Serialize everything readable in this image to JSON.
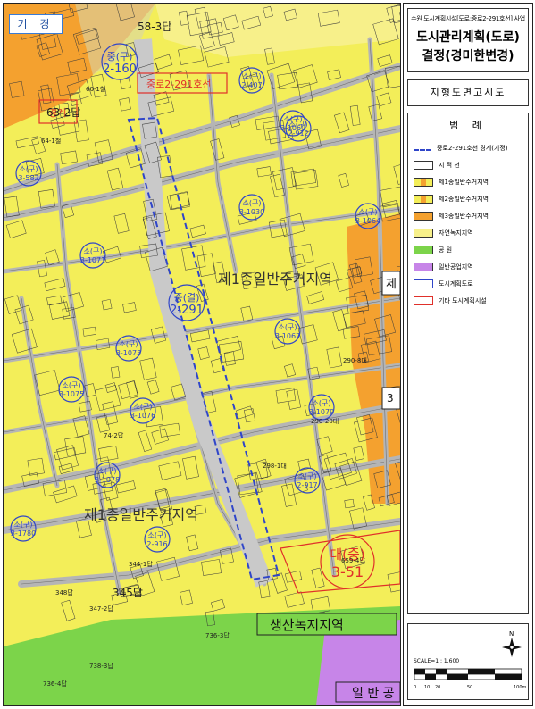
{
  "map": {
    "corner_tag": "기 경",
    "zone_labels": {
      "zone_1": "제1종일반주거지역",
      "zone_2": "제1종일반주거지역",
      "green": "생산녹지지역",
      "general": "일 반 공",
      "side_1": "제",
      "side_2": "3"
    },
    "road_labels": [
      {
        "top": "중(구)",
        "code": "2-160"
      },
      {
        "top": "소(구)",
        "code": "2-407"
      },
      {
        "top": "소(구)",
        "code": "3-1060"
      },
      {
        "top": "소(구)",
        "code": "2-912"
      },
      {
        "top": "소(구)",
        "code": "3-582"
      },
      {
        "top": "소(구)",
        "code": "3-1030"
      },
      {
        "top": "소(구)",
        "code": "3-1064"
      },
      {
        "top": "소(구)",
        "code": "3-1071"
      },
      {
        "top": "중(결)",
        "code": "2-291"
      },
      {
        "top": "소(구)",
        "code": "3-1067"
      },
      {
        "top": "소(구)",
        "code": "3-1073"
      },
      {
        "top": "소(구)",
        "code": "3-1075"
      },
      {
        "top": "소(구)",
        "code": "3-1076"
      },
      {
        "top": "소(구)",
        "code": "3-1079"
      },
      {
        "top": "소(구)",
        "code": "3-1078"
      },
      {
        "top": "소(구)",
        "code": "2-917"
      },
      {
        "top": "소(구)",
        "code": "3-1780"
      },
      {
        "top": "소(구)",
        "code": "2-916"
      }
    ],
    "facility_labels": [
      {
        "top": "대(중)",
        "code": "3-51"
      }
    ],
    "parcel_labels": [
      "58-3답",
      "60-1철",
      "63-2답",
      "64-1철",
      "290-20대",
      "290-8대",
      "345답",
      "348답",
      "347-2답",
      "736-3답",
      "738-3답",
      "659-4답",
      "344-1답",
      "298-1대",
      "74-2답",
      "736-4답"
    ],
    "overlay_labels": {
      "red_top": "중로2-291호선",
      "boundary": "경계"
    }
  },
  "sidebar": {
    "project_title": "수원 도시계획시설[도로:중로2-291호선] 사업",
    "main_title_1": "도시관리계획(도로)",
    "main_title_2": "결정(경미한변경)",
    "notice": "지형도면고시도",
    "legend_title": "범 례",
    "legend": [
      {
        "label": "중로2-291호선 경계(기정)",
        "swatch": "dashed-blue"
      },
      {
        "label": "지 적 선",
        "swatch": "plain"
      },
      {
        "label": "제1종일반주거지역",
        "swatch": "yellow-orange"
      },
      {
        "label": "제2종일반주거지역",
        "swatch": "yellow-orange"
      },
      {
        "label": "제3종일반주거지역",
        "swatch": "orange"
      },
      {
        "label": "자연녹지지역",
        "swatch": "light-yellow"
      },
      {
        "label": "공 원",
        "swatch": "green"
      },
      {
        "label": "일반공업지역",
        "swatch": "purple"
      },
      {
        "label": "도시계획도로",
        "swatch": "blue-circle"
      },
      {
        "label": "기타 도시계획시설",
        "swatch": "red"
      }
    ],
    "scale_label": "SCALE=1 : 1,600",
    "scale_ticks": [
      "0",
      "10",
      "20",
      "50",
      "100m"
    ],
    "north_label": "N"
  },
  "colors": {
    "residential": "#f3ee59",
    "road": "#b5b5b5",
    "green": "#7cd44a",
    "purple": "#c785e8",
    "orange": "#f4a12f",
    "blue": "#2f45c9",
    "red": "#e0302a",
    "parcel_line": "#3a3a3a"
  }
}
